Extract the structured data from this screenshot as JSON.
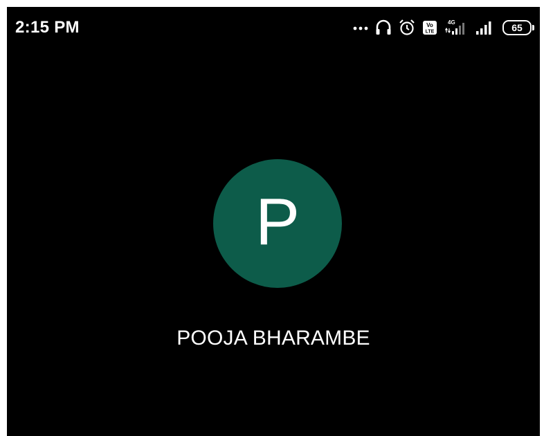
{
  "status_bar": {
    "time": "2:15 PM",
    "icons": [
      "more-dots-icon",
      "headphones-icon",
      "alarm-icon",
      "volte-icon",
      "signal-4g-icon",
      "signal-icon",
      "battery-icon"
    ],
    "volte_text": "Vo LTE",
    "network_text": "4G",
    "battery_level": "65"
  },
  "contact": {
    "initial": "P",
    "name": "POOJA BHARAMBE",
    "avatar_color": "#0d5c4a"
  },
  "colors": {
    "background": "#000000",
    "text": "#ffffff"
  }
}
